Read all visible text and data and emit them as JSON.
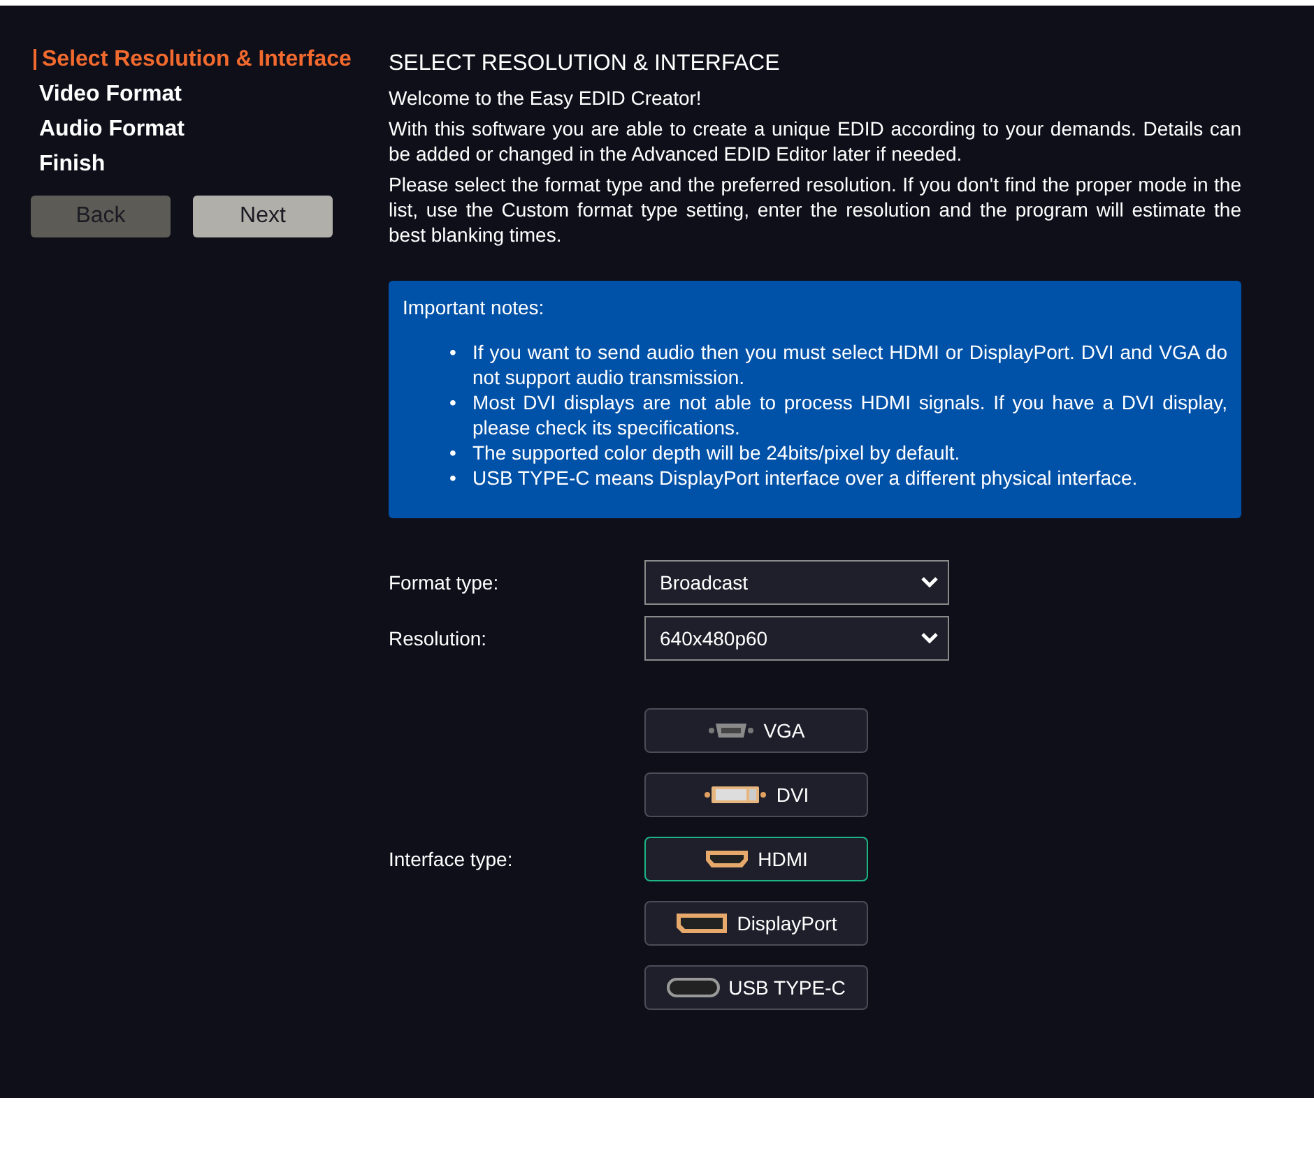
{
  "steps": [
    {
      "label": "Select Resolution & Interface",
      "selected": true
    },
    {
      "label": "Video Format",
      "selected": false
    },
    {
      "label": "Audio Format",
      "selected": false
    },
    {
      "label": "Finish",
      "selected": false
    }
  ],
  "nav_buttons": [
    {
      "label": "Back",
      "disabled": true
    },
    {
      "label": "Next",
      "disabled": false
    }
  ],
  "heading": "SELECT RESOLUTION & INTERFACE",
  "welcome": "Welcome to the Easy EDID Creator!",
  "paragraphs": [
    "With this software you are able to create a unique EDID according to your demands. Details can be added or changed in the Advanced EDID Editor later if needed.",
    "Please select the format type and the preferred resolution. If you don't find the proper mode in the list, use the Custom format type setting, enter the resolution and the program will estimate the best blanking times."
  ],
  "notes": {
    "title": "Important notes:",
    "bullet": "•",
    "items": [
      "If you want to send audio then you must select HDMI or DisplayPort. DVI and VGA do not support audio transmission.",
      "Most DVI displays are not able to process HDMI signals. If you have a DVI display, please check its specifications.",
      "The supported color depth will be 24bits/pixel by default.",
      "USB TYPE-C means DisplayPort interface over a different physical interface."
    ]
  },
  "fields": [
    {
      "label": "Format type:",
      "value": "Broadcast"
    },
    {
      "label": "Resolution:",
      "value": "640x480p60"
    }
  ],
  "interface": {
    "label": "Interface type:",
    "options": [
      {
        "label": "VGA",
        "kind": "vga",
        "selected": false
      },
      {
        "label": "DVI",
        "kind": "dvi",
        "selected": false
      },
      {
        "label": "HDMI",
        "kind": "hdmi",
        "selected": true
      },
      {
        "label": "DisplayPort",
        "kind": "displayport",
        "selected": false
      },
      {
        "label": "USB TYPE-C",
        "kind": "usbc",
        "selected": false
      }
    ]
  }
}
